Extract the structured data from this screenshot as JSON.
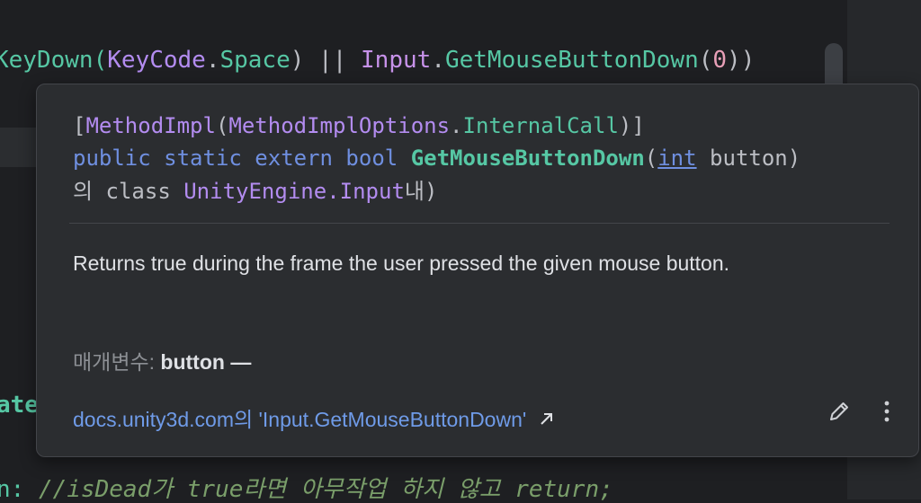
{
  "editor": {
    "code_top": {
      "t1": "KeyDown(",
      "t2": "KeyCode",
      "t3": ".",
      "t4": "Space",
      "t5": ") || ",
      "t6": "Input",
      "t7": ".",
      "t8": "GetMouseButtonDown",
      "t9": "(",
      "t10": "0",
      "t11": "))"
    },
    "code_fragment": "ate",
    "code_bottom": {
      "t1": "n: ",
      "t2": "//isDead가 true라면 아무작업 하지 않고 return;"
    }
  },
  "popup": {
    "signature": {
      "line1": {
        "open": "[",
        "attr": "MethodImpl",
        "paren_open": "(",
        "options": "MethodImplOptions",
        "dot": ".",
        "value": "InternalCall",
        "close": ")]"
      },
      "line2": {
        "modifiers": "public static extern bool ",
        "method": "GetMouseButtonDown",
        "paren_open": "(",
        "param_type": "int",
        "param_rest": " button)"
      },
      "line3": {
        "prefix": "의 class ",
        "namespace": "UnityEngine",
        "dot": ".",
        "class_name": "Input",
        "suffix": "내)"
      }
    },
    "description": "Returns true during the frame the user pressed the given mouse button.",
    "params_label": "매개변수:",
    "param_name": "button",
    "param_dash": " —",
    "link_text": "docs.unity3d.com의 'Input.GetMouseButtonDown'",
    "icons": {
      "external": "external-link-arrow",
      "edit": "pencil",
      "more": "vertical-ellipsis"
    }
  },
  "colors": {
    "background": "#1e1f22",
    "popup_background": "#2b2d30",
    "keyword_blue": "#6f8fe0",
    "method_green": "#56c7a4",
    "type_purple": "#b38cf0",
    "link_blue": "#6f9be8"
  }
}
